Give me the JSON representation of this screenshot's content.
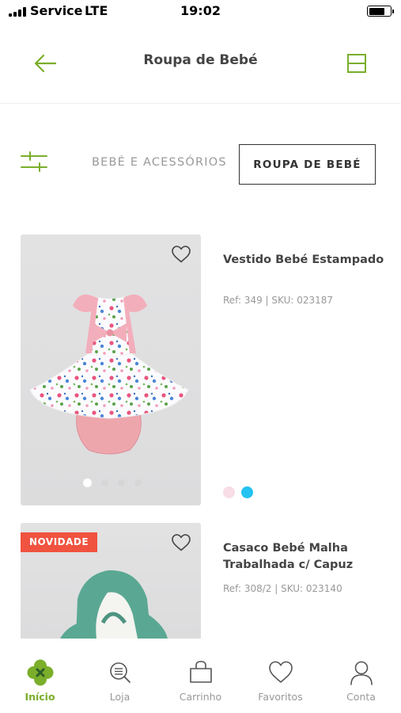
{
  "status_bar": {
    "carrier": "Service",
    "network": "LTE",
    "time": "19:02"
  },
  "header": {
    "title": "Roupa de Bebé"
  },
  "categories": {
    "inactive": "BEBÉ E ACESSÓRIOS",
    "active": "ROUPA DE BEBÉ"
  },
  "products": [
    {
      "name": "Vestido Bebé Estampado",
      "ref": "Ref: 349 | SKU: 023187",
      "swatch_colors": [
        "#f8dde6",
        "#22c3f0"
      ],
      "image_count": 4,
      "active_image": 1
    },
    {
      "badge": "NOVIDADE",
      "name": "Casaco Bebé Malha Trabalhada c/ Capuz",
      "ref": "Ref: 308/2 | SKU: 023140"
    }
  ],
  "tabs": [
    {
      "label": "Início",
      "icon": "clover-icon",
      "active": true
    },
    {
      "label": "Loja",
      "icon": "search-list-icon",
      "active": false
    },
    {
      "label": "Carrinho",
      "icon": "bag-icon",
      "active": false
    },
    {
      "label": "Favoritos",
      "icon": "heart-icon",
      "active": false
    },
    {
      "label": "Conta",
      "icon": "user-icon",
      "active": false
    }
  ],
  "colors": {
    "accent": "#7aae2b",
    "badge": "#f0533f",
    "clover_center": "#2e5e27"
  }
}
